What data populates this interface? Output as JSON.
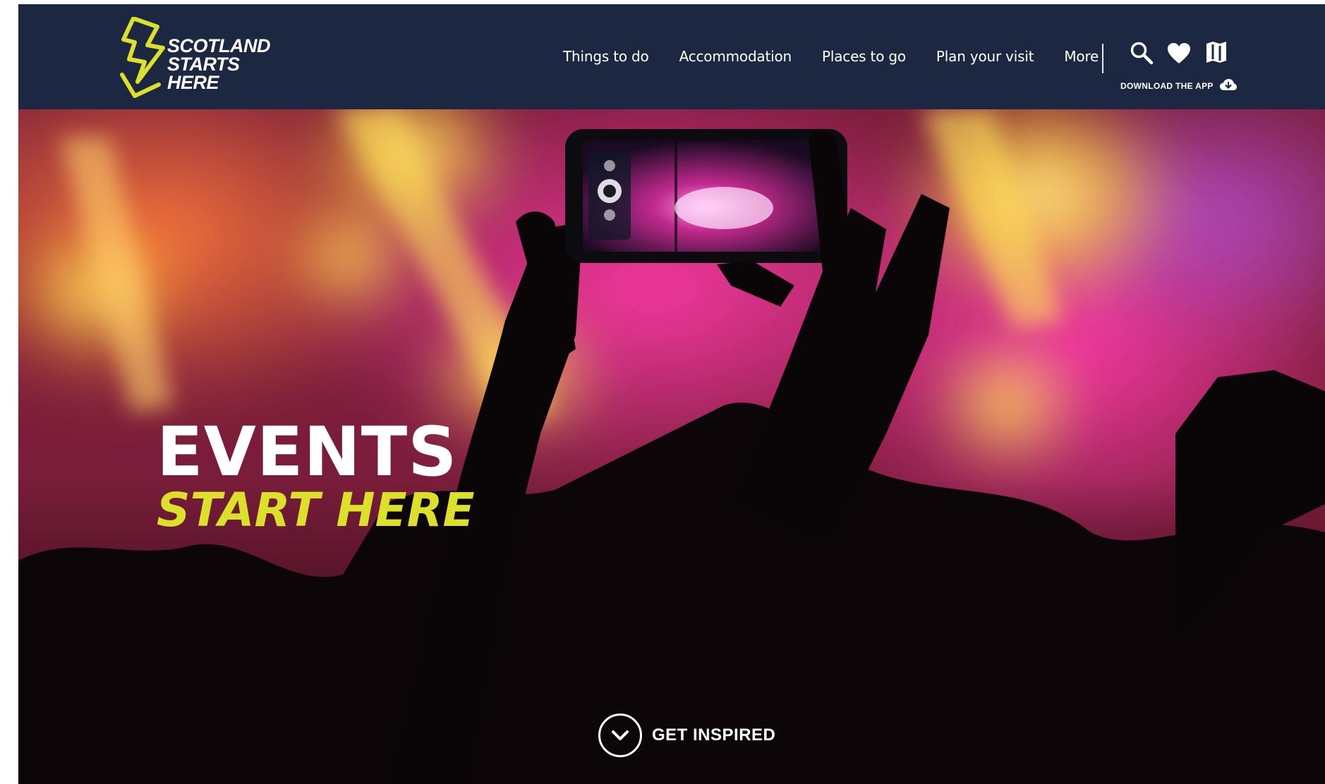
{
  "brand": {
    "logo_lines": [
      "SCOTLAND",
      "STARTS",
      "HERE"
    ],
    "logo_color": "#dce02a"
  },
  "nav": {
    "items": [
      {
        "label": "Things to do"
      },
      {
        "label": "Accommodation"
      },
      {
        "label": "Places to go"
      },
      {
        "label": "Plan your visit"
      },
      {
        "label": "More"
      }
    ]
  },
  "utility": {
    "icons": [
      "search-icon",
      "heart-icon",
      "map-icon"
    ],
    "download_label": "DOWNLOAD THE APP",
    "download_icon": "cloud-download-icon"
  },
  "hero": {
    "headline_line1": "EVENTS",
    "headline_line2": "START HERE",
    "cta_label": "GET INSPIRED",
    "cta_icon": "chevron-down-icon",
    "accent_color": "#dce02a"
  },
  "colors": {
    "header_bg": "#1c2742",
    "text": "#ffffff"
  }
}
